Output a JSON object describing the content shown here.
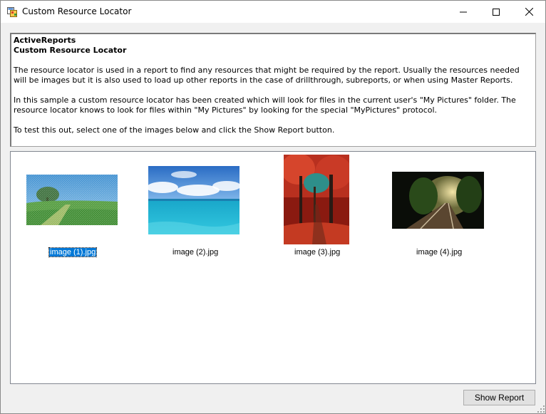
{
  "window": {
    "title": "Custom Resource Locator",
    "icon": "app-window-icon",
    "controls": [
      "minimize-icon",
      "maximize-icon",
      "close-icon"
    ]
  },
  "description": {
    "heading1": "ActiveReports",
    "heading2": "Custom Resource Locator",
    "para1": "The resource locator is used in a report to find any resources that might be required by the report.  Usually the resources needed will be images but it is also used to load up other reports in the case of drillthrough, subreports, or when using Master Reports.",
    "para2": "In this sample a custom resource locator has been created which will look for files in the current user's \"My Pictures\" folder.  The resource locator knows to look for files within \"My Pictures\" by looking for the special \"MyPictures\" protocol.",
    "para3": "To test this out, select one of the images below and click the Show Report button."
  },
  "images": [
    {
      "label": "image (1).jpg",
      "selected": true
    },
    {
      "label": "image (2).jpg",
      "selected": false
    },
    {
      "label": "image (3).jpg",
      "selected": false
    },
    {
      "label": "image (4).jpg",
      "selected": false
    }
  ],
  "buttons": {
    "show_report": "Show Report"
  },
  "colors": {
    "selection": "#0078d7",
    "button_face": "#e1e1e1"
  }
}
